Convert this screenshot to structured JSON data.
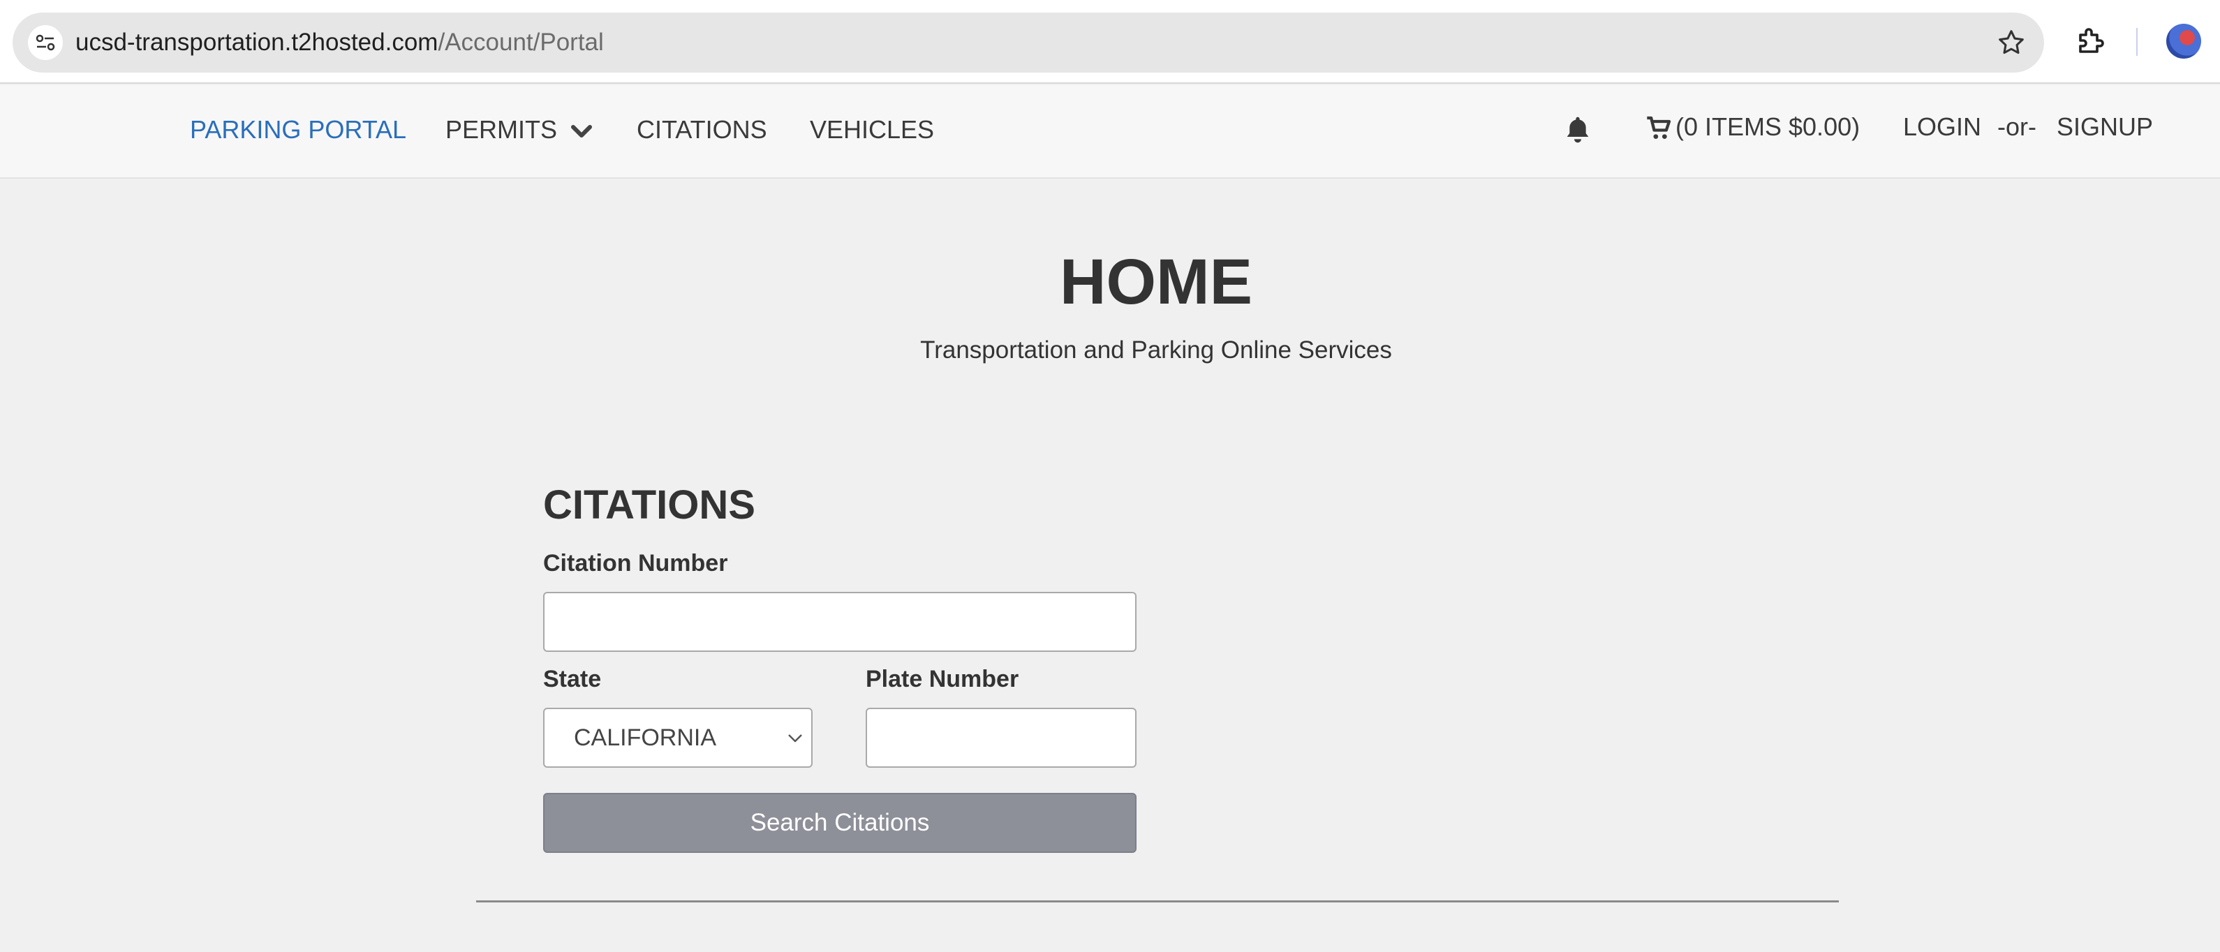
{
  "browser": {
    "url_host": "ucsd-transportation.t2hosted.com",
    "url_path": "/Account/Portal",
    "icons": [
      "tune-icon",
      "star-icon",
      "extensions-icon",
      "profile-avatar"
    ]
  },
  "navbar": {
    "items": [
      {
        "label": "PARKING PORTAL",
        "active": true
      },
      {
        "label": "PERMITS",
        "icon": "chevron-down-icon"
      },
      {
        "label": "CITATIONS"
      },
      {
        "label": "VEHICLES"
      }
    ],
    "bell_icon": "bell-icon",
    "cart_icon": "cart-icon",
    "cart_label": "(0 ITEMS $0.00)",
    "login_label": "LOGIN",
    "or_label": "-or-",
    "signup_label": "SIGNUP",
    "active_color": "#2a6ebb"
  },
  "hero": {
    "title": "HOME",
    "subtitle": "Transportation and Parking Online Services"
  },
  "citations": {
    "title": "CITATIONS",
    "citation_number_label": "Citation Number",
    "citation_number_value": "",
    "state_label": "State",
    "state_value": "CALIFORNIA",
    "plate_number_label": "Plate Number",
    "plate_number_value": "",
    "search_button_label": "Search Citations",
    "button_color": "#8d9098"
  }
}
